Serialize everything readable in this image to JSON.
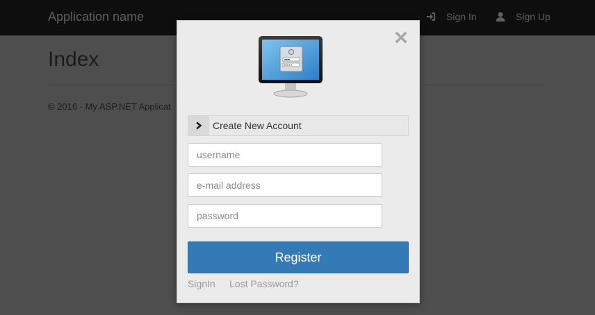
{
  "navbar": {
    "brand": "Application name",
    "signin_label": "Sign In",
    "signup_label": "Sign Up",
    "signin_icon": "sign-in-icon",
    "signup_icon": "user-icon"
  },
  "page": {
    "title": "Index",
    "footer": "© 2016 - My ASP.NET Applicat"
  },
  "modal": {
    "close_icon": "close-icon",
    "illustration_icon": "monitor-login-icon",
    "section_header": "Create New Account",
    "section_icon": "chevron-right-icon",
    "fields": {
      "username_placeholder": "username",
      "email_placeholder": "e-mail address",
      "password_placeholder": "password"
    },
    "register_label": "Register",
    "signin_link": "SignIn",
    "lost_password_link": "Lost Password?"
  },
  "colors": {
    "backdrop": "#4e4e4e",
    "navbar": "#0e0e0e",
    "modal_bg": "#ebebeb",
    "primary_button": "#337ab7",
    "link": "#9a9a9a"
  }
}
